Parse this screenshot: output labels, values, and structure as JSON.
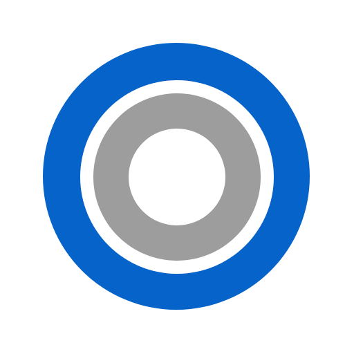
{
  "logo": {
    "icon": "concentric-rings-icon",
    "colors": {
      "outer": "#0563c9",
      "gap": "#ffffff",
      "inner": "#9d9d9d",
      "center": "#ffffff",
      "background": "#ffffff"
    }
  }
}
